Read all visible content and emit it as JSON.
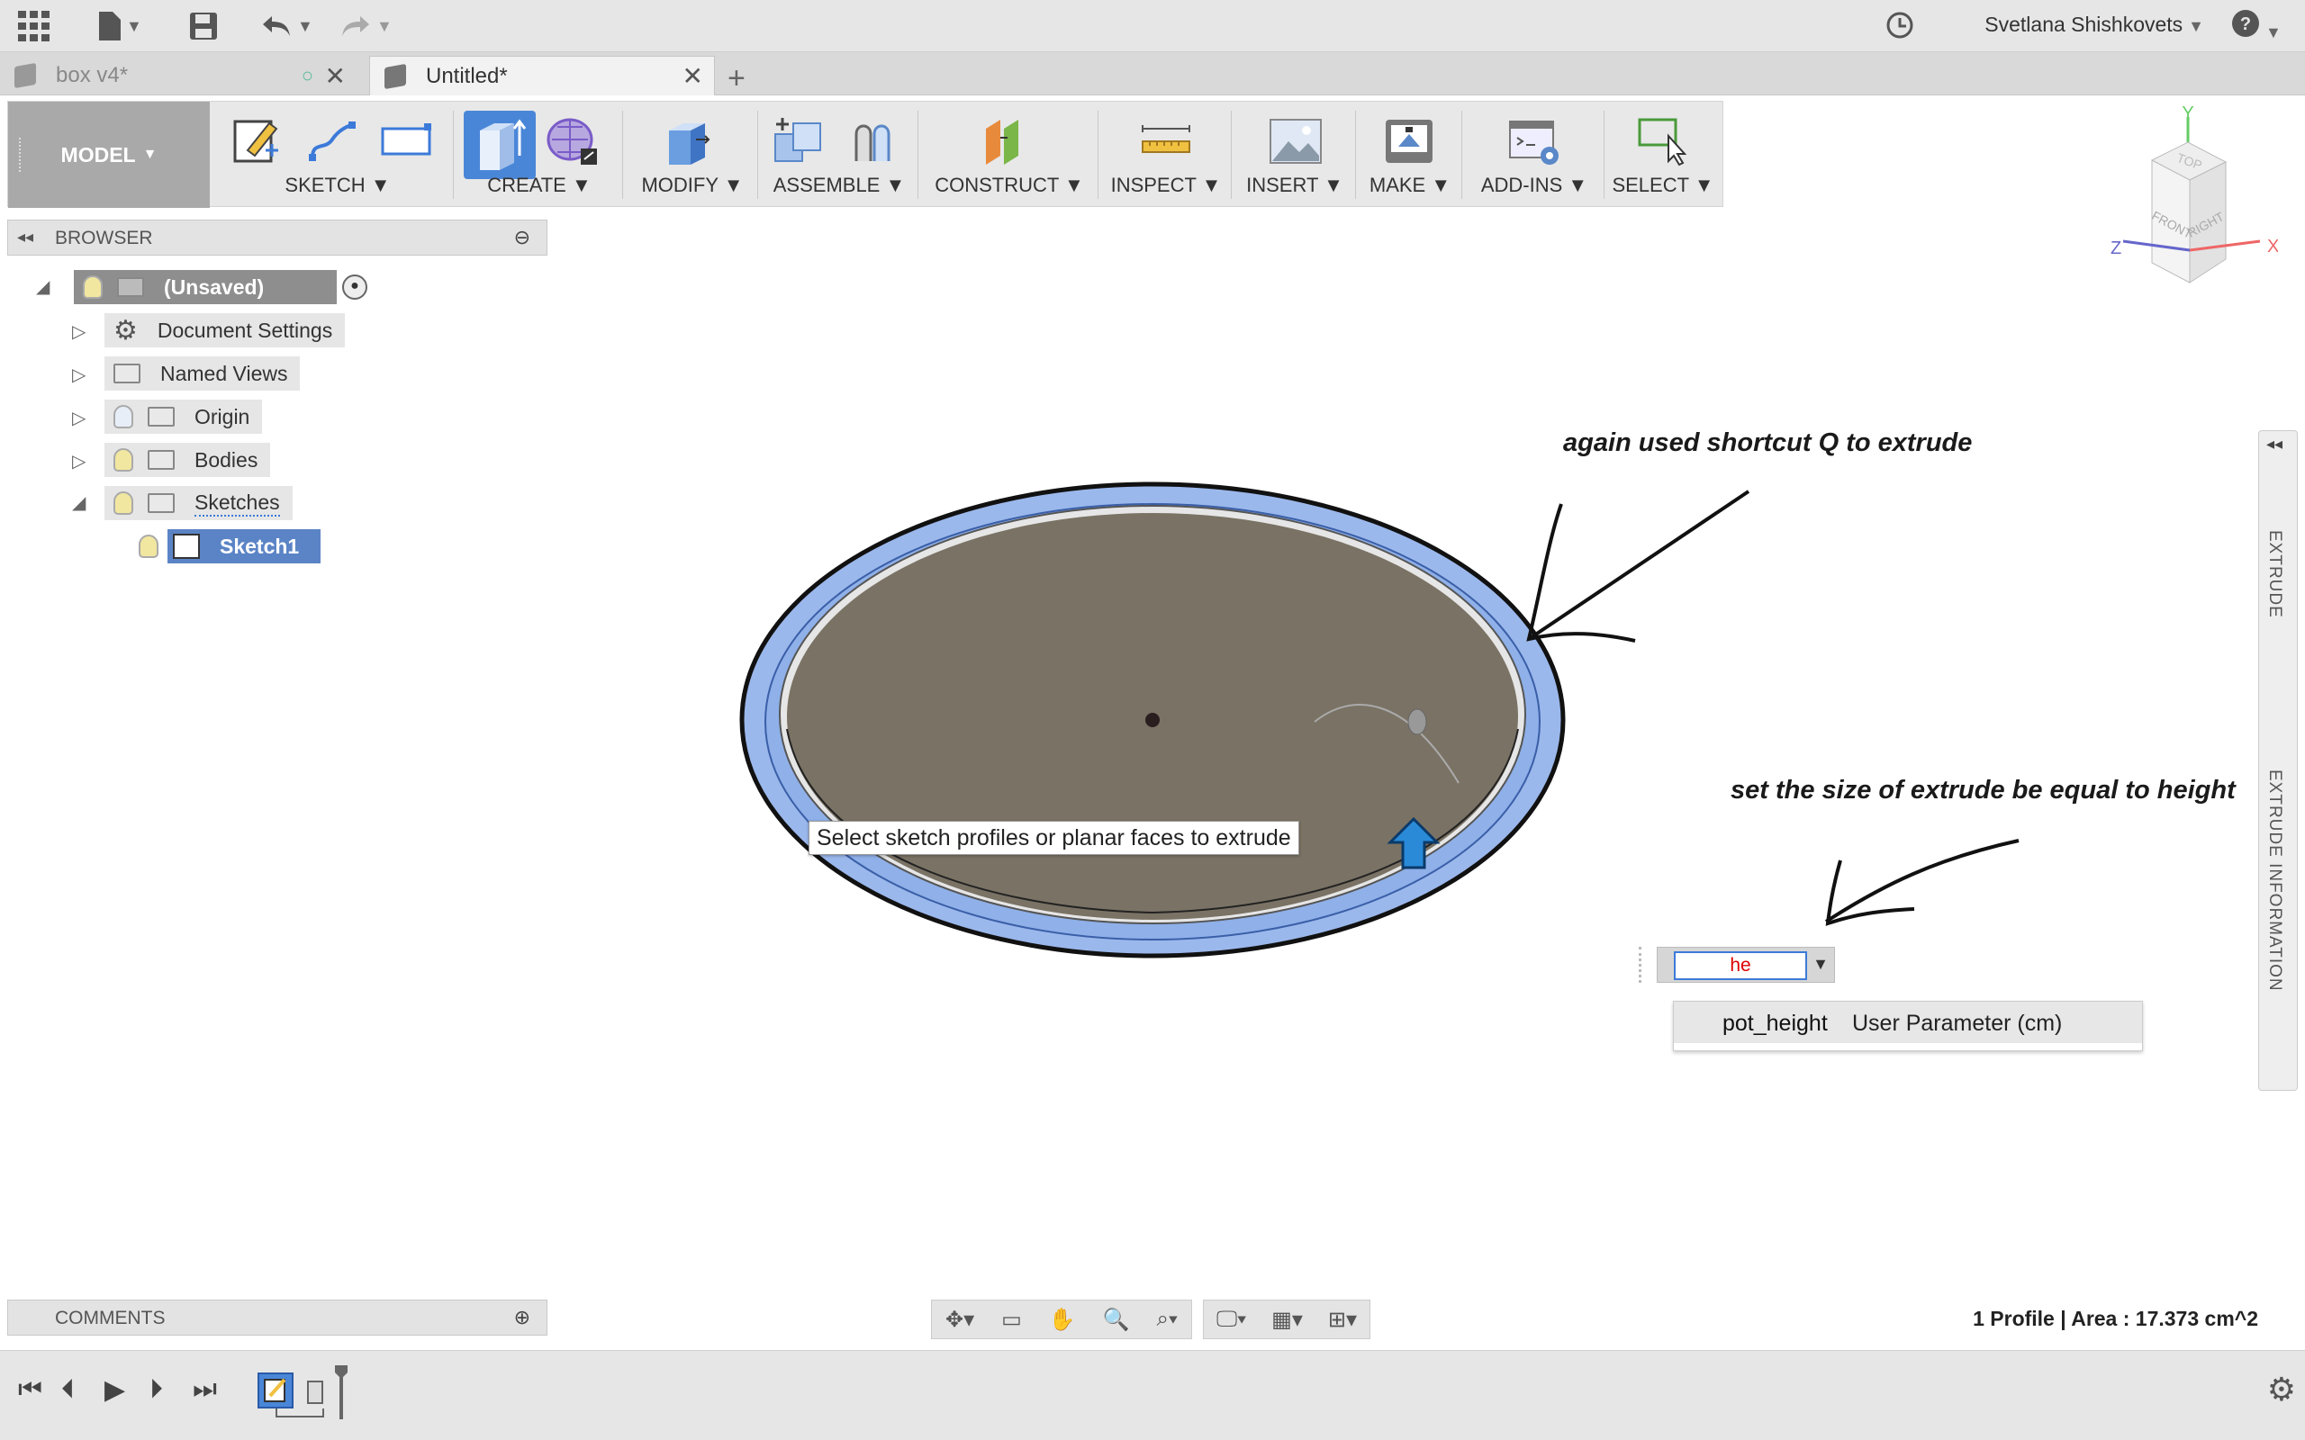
{
  "topbar": {
    "user_name": "Svetlana Shishkovets",
    "help_label": "?"
  },
  "tabs": [
    {
      "label": "box v4*",
      "active": false
    },
    {
      "label": "Untitled*",
      "active": true
    }
  ],
  "toolbar": {
    "workspace": "MODEL",
    "groups": [
      "SKETCH",
      "CREATE",
      "MODIFY",
      "ASSEMBLE",
      "CONSTRUCT",
      "INSPECT",
      "INSERT",
      "MAKE",
      "ADD-INS",
      "SELECT"
    ]
  },
  "browser": {
    "title": "BROWSER",
    "root": "(Unsaved)",
    "items": [
      {
        "label": "Document Settings"
      },
      {
        "label": "Named Views"
      },
      {
        "label": "Origin"
      },
      {
        "label": "Bodies"
      },
      {
        "label": "Sketches"
      },
      {
        "label": "Sketch1"
      }
    ]
  },
  "comments": {
    "title": "COMMENTS"
  },
  "canvas": {
    "tooltip": "Select sketch profiles or planar faces to extrude",
    "annotation_1": "again used shortcut Q to extrude",
    "annotation_2": "set the size of extrude be equal to height"
  },
  "extrude_input": {
    "value": "he",
    "suggestion_name": "pot_height",
    "suggestion_desc": "User Parameter (cm)"
  },
  "side_panel": {
    "label_1": "EXTRUDE",
    "label_2": "EXTRUDE INFORMATION"
  },
  "viewcube": {
    "top": "TOP",
    "front": "FRONT",
    "right": "RIGHT",
    "x": "X",
    "y": "Y",
    "z": "Z"
  },
  "status": "1 Profile | Area : 17.373 cm^2",
  "colors": {
    "accent": "#3c7ad9",
    "selection_blue": "#8fb0e8",
    "face": "#7a7264"
  }
}
